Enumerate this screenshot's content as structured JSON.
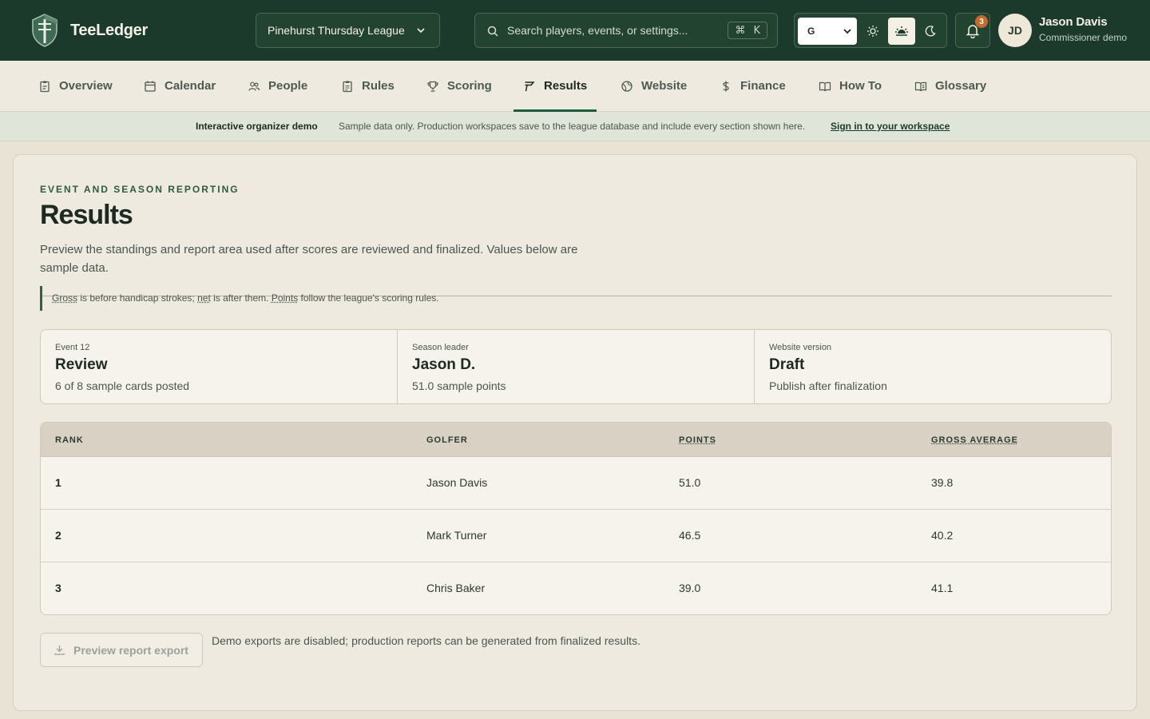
{
  "app": {
    "name": "TeeLedger",
    "league": "Pinehurst Thursday League",
    "search_placeholder": "Search players, events, or settings...",
    "shortcut_key": "K",
    "language": "G",
    "notifications_count": "3",
    "user": {
      "initials": "JD",
      "name": "Jason Davis",
      "role": "Commissioner demo"
    }
  },
  "nav": {
    "tabs": [
      {
        "label": "Overview",
        "icon": "clipboard-icon"
      },
      {
        "label": "Calendar",
        "icon": "calendar-icon"
      },
      {
        "label": "People",
        "icon": "people-icon"
      },
      {
        "label": "Rules",
        "icon": "rules-icon"
      },
      {
        "label": "Scoring",
        "icon": "trophy-icon"
      },
      {
        "label": "Results",
        "icon": "flag-icon",
        "active": true
      },
      {
        "label": "Website",
        "icon": "globe-icon"
      },
      {
        "label": "Finance",
        "icon": "dollar-icon"
      },
      {
        "label": "How To",
        "icon": "book-icon"
      },
      {
        "label": "Glossary",
        "icon": "glossary-icon"
      }
    ]
  },
  "banner": {
    "title": "Interactive organizer demo",
    "text": "Sample data only. Production workspaces save to the league database and include every section shown here.",
    "link": "Sign in to your workspace"
  },
  "page": {
    "eyebrow": "EVENT AND SEASON REPORTING",
    "title": "Results",
    "description": "Preview the standings and report area used after scores are reviewed and finalized. Values below are sample data.",
    "note": {
      "term_gross": "Gross",
      "text_1": " is before handicap strokes; ",
      "term_net": "net",
      "text_2": " is after them. ",
      "term_points": "Points",
      "text_3": " follow the league's scoring rules."
    }
  },
  "stats": [
    {
      "label": "Event 12",
      "value": "Review",
      "sub": "6 of 8 sample cards posted"
    },
    {
      "label": "Season leader",
      "value": "Jason D.",
      "sub": "51.0 sample points"
    },
    {
      "label": "Website version",
      "value": "Draft",
      "sub": "Publish after finalization"
    }
  ],
  "standings": {
    "headers": {
      "rank": "RANK",
      "golfer": "GOLFER",
      "points": "POINTS",
      "gross_average": "GROSS AVERAGE"
    },
    "rows": [
      {
        "rank": "1",
        "golfer": "Jason Davis",
        "points": "51.0",
        "gross_average": "39.8"
      },
      {
        "rank": "2",
        "golfer": "Mark Turner",
        "points": "46.5",
        "gross_average": "40.2"
      },
      {
        "rank": "3",
        "golfer": "Chris Baker",
        "points": "39.0",
        "gross_average": "41.1"
      }
    ]
  },
  "export": {
    "button_label": "Preview report export",
    "note": "Demo exports are disabled; production reports can be generated from finalized results."
  },
  "colors": {
    "brand_dark_green": "#1b3a2c",
    "accent_green": "#1f5a40",
    "badge_orange": "#c76a2f",
    "page_background": "#e9e3d6"
  }
}
